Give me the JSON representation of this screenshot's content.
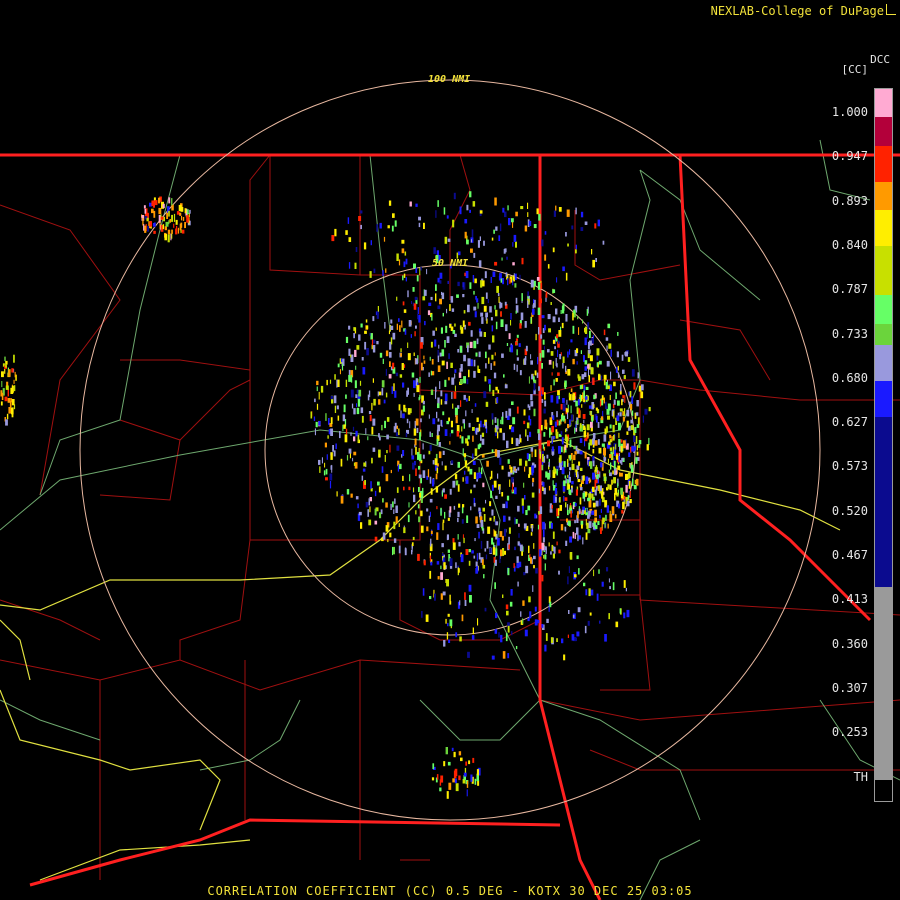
{
  "header": {
    "credit": "NEXLAB-College of DuPage",
    "station": "DCC",
    "units": "[CC]"
  },
  "rings": {
    "outer_label": "100 NMI",
    "inner_label": "50 NMI"
  },
  "legend": {
    "ticks": [
      "1.000",
      "0.947",
      "0.893",
      "0.840",
      "0.787",
      "0.733",
      "0.680",
      "0.627",
      "0.573",
      "0.520",
      "0.467",
      "0.413",
      "0.360",
      "0.307",
      "0.253",
      "TH"
    ],
    "colors": {
      "pink": "#ffaad2",
      "darkred": "#b3003a",
      "red": "#ff2200",
      "orange": "#ff9a00",
      "yellow": "#ffee00",
      "yellowgreen": "#c8e000",
      "green": "#6bd43c",
      "lightgreen": "#66ff66",
      "lavender": "#9999dd",
      "blue": "#1a1aff",
      "navy": "#0b0b8f",
      "gray": "#9a9a9a",
      "black": "#000000"
    }
  },
  "map": {
    "border_color": "#ff2020",
    "county_color": "#a01010",
    "highway_color": "#e0e040",
    "river_color": "#6ea86e",
    "ring_color": "#e8b8a0"
  },
  "caption": "CORRELATION COEFFICIENT (CC) 0.5 DEG - KOTX 30 DEC 25 03:05"
}
